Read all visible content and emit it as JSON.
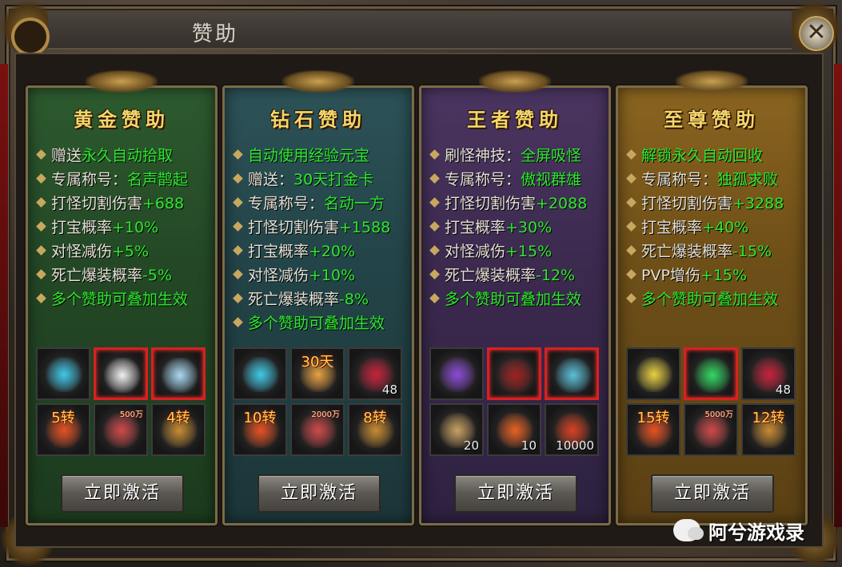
{
  "window": {
    "title": "赞助",
    "close_glyph": "✕"
  },
  "cards": [
    {
      "title": "黄金赞助",
      "button": "立即激活",
      "lines": [
        {
          "label": "赠送",
          "value": "永久自动拾取"
        },
        {
          "label": "专属称号：",
          "value": "名声鹊起"
        },
        {
          "label": "打怪切割伤害",
          "value": "+688"
        },
        {
          "label": "打宝概率",
          "value": "+10%"
        },
        {
          "label": "对怪减伤",
          "value": "+5%"
        },
        {
          "label": "死亡爆装概率",
          "value": "-5%"
        },
        {
          "label": "",
          "value": "多个赞助可叠加生效"
        }
      ],
      "items": [
        {
          "icon": "cyan-blade-icon",
          "tag": "",
          "qty": "",
          "rare": false
        },
        {
          "icon": "lion-mask-icon",
          "tag": "",
          "qty": "",
          "rare": true
        },
        {
          "icon": "spirit-figure-icon",
          "tag": "",
          "qty": "",
          "rare": true
        },
        {
          "icon": "fire-orb-icon",
          "tag": "5转",
          "qty": "",
          "rare": false
        },
        {
          "icon": "scroll-icon",
          "tag": "500万",
          "qty": "",
          "rare": false
        },
        {
          "icon": "treasure-chest-icon",
          "tag": "4转",
          "qty": "",
          "rare": false
        }
      ]
    },
    {
      "title": "钻石赞助",
      "button": "立即激活",
      "lines": [
        {
          "label": "",
          "value": "自动使用经验元宝"
        },
        {
          "label": "赠送：",
          "value": "30天打金卡"
        },
        {
          "label": "专属称号：",
          "value": "名动一方"
        },
        {
          "label": "打怪切割伤害",
          "value": "+1588"
        },
        {
          "label": "打宝概率",
          "value": "+20%"
        },
        {
          "label": "对怪减伤",
          "value": "+10%"
        },
        {
          "label": "死亡爆装概率",
          "value": "-8%"
        },
        {
          "label": "",
          "value": "多个赞助可叠加生效"
        }
      ],
      "items": [
        {
          "icon": "cyan-blade-icon",
          "tag": "",
          "qty": "",
          "rare": false
        },
        {
          "icon": "gold-card-icon",
          "tag": "30天",
          "qty": "",
          "rare": false
        },
        {
          "icon": "red-gem-icon",
          "tag": "",
          "qty": "48",
          "rare": false
        },
        {
          "icon": "fire-orb-icon",
          "tag": "10转",
          "qty": "",
          "rare": false
        },
        {
          "icon": "scroll-icon",
          "tag": "2000万",
          "qty": "",
          "rare": false
        },
        {
          "icon": "treasure-chest-icon",
          "tag": "8转",
          "qty": "",
          "rare": false
        }
      ]
    },
    {
      "title": "王者赞助",
      "button": "立即激活",
      "lines": [
        {
          "label": "刷怪神技：",
          "value": "全屏吸怪"
        },
        {
          "label": "专属称号：",
          "value": "傲视群雄"
        },
        {
          "label": "打怪切割伤害",
          "value": "+2088"
        },
        {
          "label": "打宝概率",
          "value": "+30%"
        },
        {
          "label": "对怪减伤",
          "value": "+15%"
        },
        {
          "label": "死亡爆装概率",
          "value": "-12%"
        },
        {
          "label": "",
          "value": "多个赞助可叠加生效"
        }
      ],
      "items": [
        {
          "icon": "purple-blade-icon",
          "tag": "",
          "qty": "",
          "rare": false
        },
        {
          "icon": "red-book-icon",
          "tag": "",
          "qty": "",
          "rare": true
        },
        {
          "icon": "crystal-star-icon",
          "tag": "",
          "qty": "",
          "rare": true
        },
        {
          "icon": "parchment-icon",
          "tag": "",
          "qty": "20",
          "rare": false
        },
        {
          "icon": "fire-book-icon",
          "tag": "",
          "qty": "10",
          "rare": false
        },
        {
          "icon": "fire-coin-icon",
          "tag": "",
          "qty": "10000",
          "rare": false
        }
      ]
    },
    {
      "title": "至尊赞助",
      "button": "立即激活",
      "lines": [
        {
          "label": "",
          "value": "解锁永久自动回收"
        },
        {
          "label": "专属称号：",
          "value": "独孤求败"
        },
        {
          "label": "打怪切割伤害",
          "value": "+3288"
        },
        {
          "label": "打宝概率",
          "value": "+40%"
        },
        {
          "label": "死亡爆装概率",
          "value": "-15%"
        },
        {
          "label": "PVP增伤",
          "value": "+15%"
        },
        {
          "label": "",
          "value": "多个赞助可叠加生效"
        }
      ],
      "items": [
        {
          "icon": "gold-blade-icon",
          "tag": "",
          "qty": "",
          "rare": false
        },
        {
          "icon": "green-wings-icon",
          "tag": "",
          "qty": "",
          "rare": true
        },
        {
          "icon": "red-gem-icon",
          "tag": "",
          "qty": "48",
          "rare": false
        },
        {
          "icon": "fire-orb-icon",
          "tag": "15转",
          "qty": "",
          "rare": false
        },
        {
          "icon": "scroll-icon",
          "tag": "5000万",
          "qty": "",
          "rare": false
        },
        {
          "icon": "treasure-chest-icon",
          "tag": "12转",
          "qty": "",
          "rare": false
        }
      ]
    }
  ],
  "icon_colors": {
    "cyan-blade-icon": "#3fc8e8",
    "purple-blade-icon": "#8a4ad8",
    "gold-blade-icon": "#e8d040",
    "lion-mask-icon": "#f0f0f0",
    "spirit-figure-icon": "#a8d8f0",
    "fire-orb-icon": "#e85020",
    "scroll-icon": "#d04848",
    "treasure-chest-icon": "#c88a30",
    "gold-card-icon": "#e8a040",
    "red-gem-icon": "#c8203a",
    "red-book-icon": "#a02020",
    "crystal-star-icon": "#58c0d8",
    "parchment-icon": "#c8a060",
    "fire-book-icon": "#e86020",
    "fire-coin-icon": "#d84020",
    "green-wings-icon": "#30d860"
  },
  "watermark": "阿兮游戏录"
}
